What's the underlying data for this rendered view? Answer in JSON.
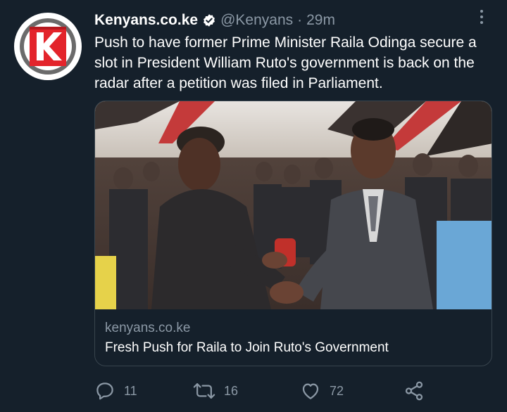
{
  "account": {
    "display_name": "Kenyans.co.ke",
    "handle": "@Kenyans",
    "separator": "·",
    "time": "29m",
    "logo_letter": "K",
    "logo_color": "#e3242b"
  },
  "tweet": {
    "text": "Push to have former Prime Minister Raila Odinga secure a slot in President William Ruto's government is back on the radar after a petition was filed in Parliament."
  },
  "card": {
    "domain": "kenyans.co.ke",
    "title": "Fresh Push for Raila to Join Ruto's Government",
    "image_description_icon": "photo-handshake"
  },
  "actions": {
    "reply_count": "11",
    "retweet_count": "16",
    "like_count": "72"
  },
  "colors": {
    "background": "#15202b",
    "muted": "#8b98a5",
    "border": "#38444d",
    "verified": "#ffffff"
  }
}
